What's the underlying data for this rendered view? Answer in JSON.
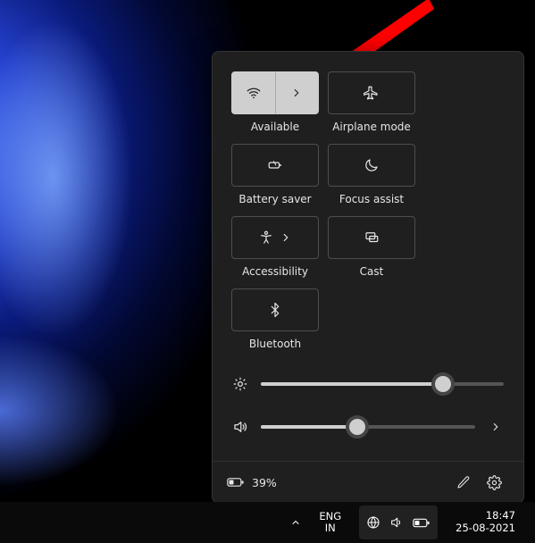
{
  "tiles": {
    "wifi": {
      "label": "Available"
    },
    "airplane": {
      "label": "Airplane mode"
    },
    "battery": {
      "label": "Battery saver"
    },
    "focus": {
      "label": "Focus assist"
    },
    "accessibility": {
      "label": "Accessibility"
    },
    "cast": {
      "label": "Cast"
    },
    "bluetooth": {
      "label": "Bluetooth"
    }
  },
  "sliders": {
    "brightness": {
      "value": 75
    },
    "volume": {
      "value": 45
    }
  },
  "footer": {
    "battery_text": "39%"
  },
  "taskbar": {
    "lang_top": "ENG",
    "lang_bottom": "IN",
    "time": "18:47",
    "date": "25-08-2021"
  }
}
